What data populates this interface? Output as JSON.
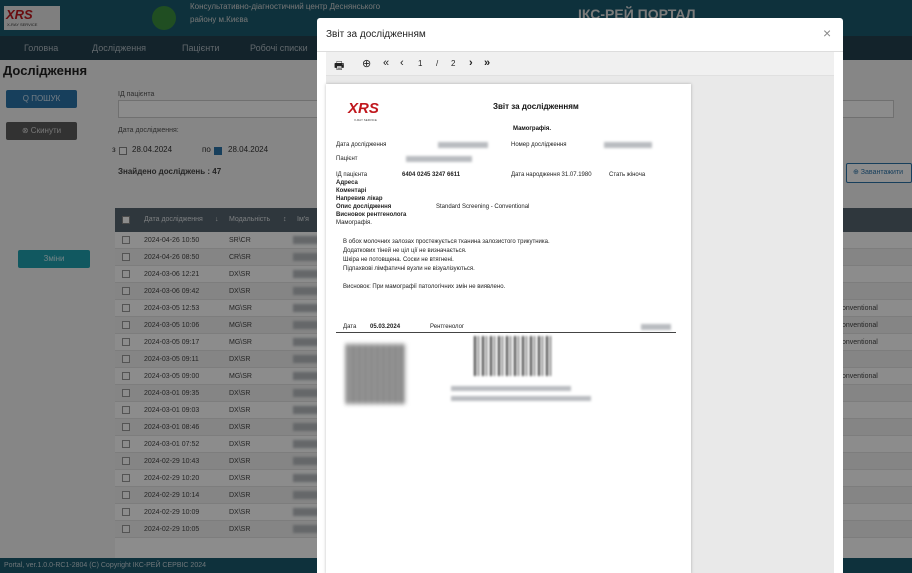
{
  "header": {
    "logo_text": "XRS",
    "logo_sub": "X-RAY SERVICE",
    "org_line1": "Консультативно-діагностичний центр Деснянського",
    "org_line2": "району м.Києва",
    "portal_title": "ІКС-РЕЙ ПОРТАЛ"
  },
  "nav": [
    "Головна",
    "Дослідження",
    "Пацієнти",
    "Робочі списки"
  ],
  "page": {
    "title": "Дослідження",
    "search_button": "Q ПОШУК",
    "reset_button": "⊗ Скинути",
    "patient_id_label": "ІД пацієнта",
    "date_label": "Дата дослідження:",
    "date_from_prefix": "з",
    "date_from": "28.04.2024",
    "date_to_prefix": "по",
    "date_to": "28.04.2024",
    "found": "Знайдено досліджень : 47",
    "download_button": "⊕ Завантажити",
    "green_button": "Зміни"
  },
  "table": {
    "headers": [
      "Дата дослідження",
      "↓",
      "Модальність",
      "↕",
      "Ім'я"
    ],
    "rows": [
      {
        "date": "2024-04-26 10:50",
        "mod": "SR\\CR",
        "desc": ""
      },
      {
        "date": "2024-04-26 08:50",
        "mod": "CR\\SR",
        "desc": ""
      },
      {
        "date": "2024-03-06 12:21",
        "mod": "DX\\SR",
        "desc": ""
      },
      {
        "date": "2024-03-06 09:42",
        "mod": "DX\\SR",
        "desc": ""
      },
      {
        "date": "2024-03-05 12:53",
        "mod": "MG\\SR",
        "desc": "onventional"
      },
      {
        "date": "2024-03-05 10:06",
        "mod": "MG\\SR",
        "desc": "onventional"
      },
      {
        "date": "2024-03-05 09:17",
        "mod": "MG\\SR",
        "desc": "onventional"
      },
      {
        "date": "2024-03-05 09:11",
        "mod": "DX\\SR",
        "desc": ""
      },
      {
        "date": "2024-03-05 09:00",
        "mod": "MG\\SR",
        "desc": "onventional"
      },
      {
        "date": "2024-03-01 09:35",
        "mod": "DX\\SR",
        "desc": ""
      },
      {
        "date": "2024-03-01 09:03",
        "mod": "DX\\SR",
        "desc": ""
      },
      {
        "date": "2024-03-01 08:46",
        "mod": "DX\\SR",
        "desc": ""
      },
      {
        "date": "2024-03-01 07:52",
        "mod": "DX\\SR",
        "desc": ""
      },
      {
        "date": "2024-02-29 10:43",
        "mod": "DX\\SR",
        "desc": ""
      },
      {
        "date": "2024-02-29 10:20",
        "mod": "DX\\SR",
        "desc": ""
      },
      {
        "date": "2024-02-29 10:14",
        "mod": "DX\\SR",
        "desc": ""
      },
      {
        "date": "2024-02-29 10:09",
        "mod": "DX\\SR",
        "desc": ""
      },
      {
        "date": "2024-02-29 10:05",
        "mod": "DX\\SR",
        "desc": ""
      }
    ]
  },
  "footer": "Portal, ver.1.0.0-RC1-2804 (C) Copyright ІКС-РЕЙ СЕРВІС 2024",
  "modal": {
    "title": "Звіт за дослідженням",
    "close": "×",
    "toolbar": {
      "print": "🖶",
      "zoom": "⊕",
      "first": "«",
      "prev": "‹",
      "page": "1",
      "sep": "/",
      "total": "2",
      "next": "›",
      "last": "»"
    }
  },
  "report": {
    "logo": "XRS",
    "logo_sub": "X-RAY SERVICE",
    "title": "Звіт за дослідженням",
    "subtitle": "Мамографія.",
    "study_date_label": "Дата дослідження",
    "study_number_label": "Номер дослідження",
    "patient_label": "Пацієнт",
    "pid_label": "ІД пацієнта",
    "pid_value": "6404  0245  3247  6611",
    "dob": "Дата народження 31.07.1980",
    "sex": "Стать жінoча",
    "address_label": "Адреса",
    "comments_label": "Коментарі",
    "referrer_label": "Напревив лікар",
    "desc_label": "Опис дослідження",
    "desc_value": "Standard Screening - Conventional",
    "conclusion_label": "Висновок рентгенолога",
    "modality": "Мамографія.",
    "text_lines": [
      "В обох молочних залозах простежується тканина залозистого трикутника.",
      "Додаткових тіней не ціл ції не визначається.",
      "Шкіра не потовщена. Соски не втягнені.",
      "Підпахвові лімфатичні вузли не візуалізуються."
    ],
    "conclusion": "Висновок: При мамографії патологічних змін не виявлено.",
    "sign_date_label": "Дата",
    "sign_date": "05.03.2024",
    "radiologist_label": "Рентгенолог"
  }
}
